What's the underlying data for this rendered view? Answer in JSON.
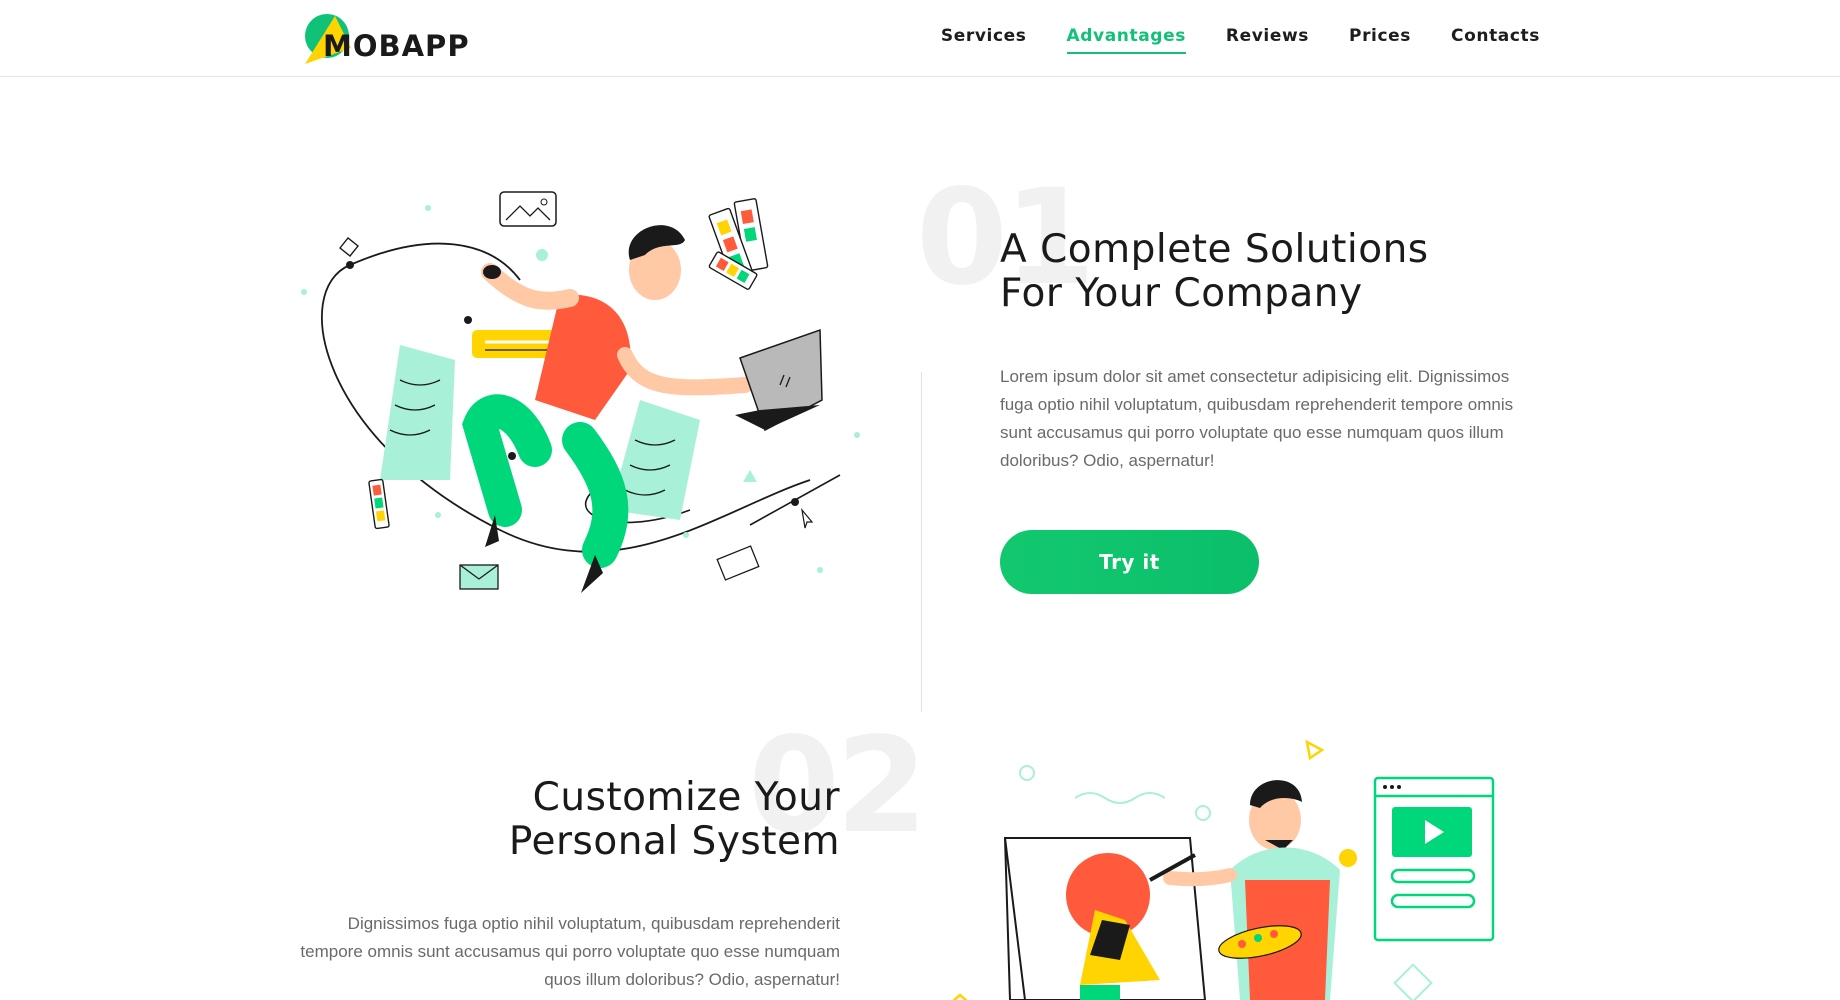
{
  "header": {
    "logo_text": "MOBAPP",
    "nav": [
      {
        "label": "Services"
      },
      {
        "label": "Advantages",
        "active": true
      },
      {
        "label": "Reviews"
      },
      {
        "label": "Prices"
      },
      {
        "label": "Contacts"
      }
    ]
  },
  "section1": {
    "number": "01",
    "title_line1": "A Complete Solutions",
    "title_line2": "For Your Company",
    "body": "Lorem ipsum dolor sit amet consectetur adipisicing elit. Dignissimos fuga optio nihil voluptatum, quibusdam reprehenderit tempore omnis sunt accusamus qui porro voluptate quo esse numquam quos illum doloribus? Odio, aspernatur!",
    "button_label": "Try it"
  },
  "section2": {
    "number": "02",
    "title_line1": "Customize Your",
    "title_line2": "Personal System",
    "body": "Dignissimos fuga optio nihil voluptatum, quibusdam reprehenderit tempore omnis sunt accusamus qui porro voluptate quo esse numquam quos illum doloribus? Odio, aspernatur!"
  },
  "colors": {
    "accent": "#10c178",
    "mint": "#a8f0d8",
    "orange": "#ff5a3c",
    "yellow": "#ffd400",
    "skin": "#ffc9a6"
  },
  "icons": [
    "logo-icon",
    "image-icon",
    "pen-tool-icon",
    "laptop-icon",
    "envelope-icon",
    "cursor-icon",
    "color-palette-icon",
    "play-icon"
  ]
}
